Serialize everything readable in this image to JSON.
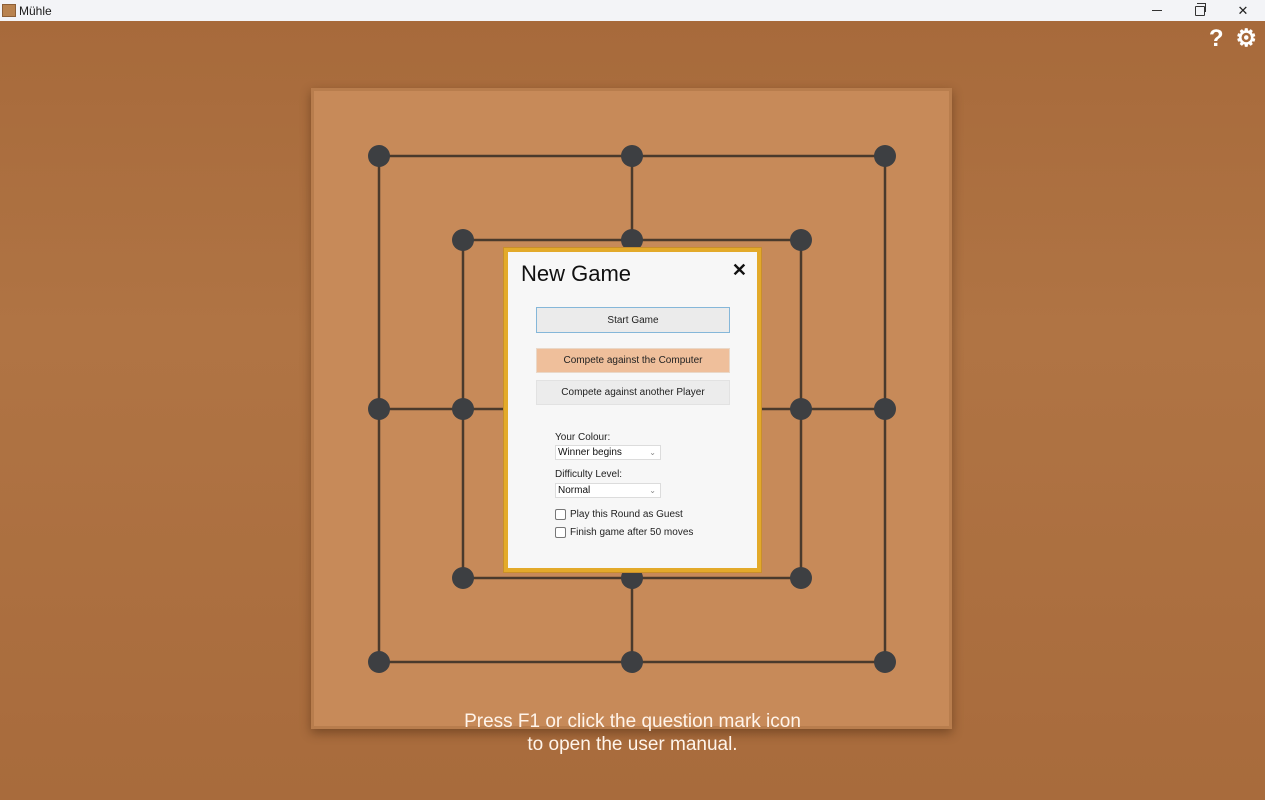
{
  "window": {
    "title": "Mühle",
    "controls": {
      "minimize": "minimize",
      "restore": "restore",
      "close": "close"
    }
  },
  "toolbar": {
    "help_icon": "?",
    "settings_icon": "⚙"
  },
  "board": {
    "type": "nine-men's-morris",
    "points_per_ring": 8,
    "rings": 3,
    "pieces_placed": 0
  },
  "hint": {
    "line1": "Press F1 or click the question mark icon",
    "line2": "to open the user manual."
  },
  "dialog": {
    "title": "New Game",
    "close_icon": "✕",
    "start_button": "Start Game",
    "mode_computer": "Compete against the Computer",
    "mode_player": "Compete against another Player",
    "selected_mode": "computer",
    "colour_label": "Your Colour:",
    "colour_value": "Winner begins",
    "difficulty_label": "Difficulty Level:",
    "difficulty_value": "Normal",
    "guest_label": "Play this Round as Guest",
    "guest_checked": false,
    "fifty_moves_label": "Finish game after 50 moves",
    "fifty_moves_checked": false
  },
  "colors": {
    "table": "#a76a3b",
    "board": "#c78a59",
    "point": "#3d3f42",
    "line": "#4a3a2c",
    "dialog_border": "#e3aa2a",
    "selected_mode": "#efbf9b"
  }
}
